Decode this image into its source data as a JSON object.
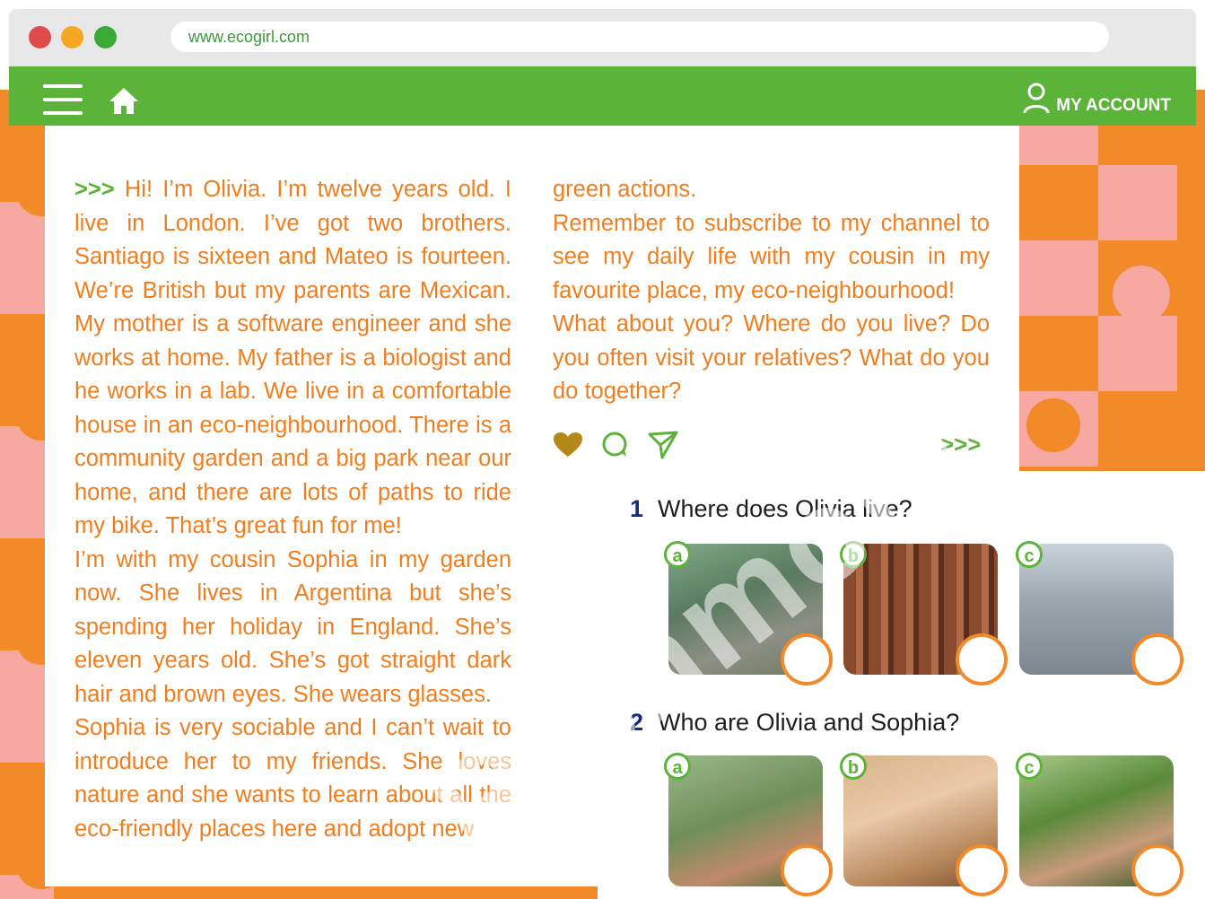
{
  "browser": {
    "url": "www.ecogirl.com",
    "traffic_lights": [
      "#e04a4a",
      "#f5a623",
      "#3aaa35"
    ]
  },
  "navbar": {
    "menu_icon": "hamburger-menu-icon",
    "home_icon": "home-icon",
    "account_icon": "user-icon",
    "account_label": "MY ACCOUNT"
  },
  "post": {
    "intro_arrows": ">>>",
    "col1_text": "Hi! I’m Olivia. I’m twelve years old. I live in London. I’ve got two brothers. Santiago is sixteen and Mateo is fourteen. We’re British but my parents are Mexican. My mother is a software engineer and she works at home. My father is a biologist and he works in a lab. We live in a comfortable house in an eco-neighbourhood. There is a community garden and a big park near our home, and there are lots of paths to ride my bike. That’s great fun for me!",
    "col1_text2": "I’m with my cousin Sophia in my garden now. She lives in Argentina but she’s spending her holiday in England. She’s eleven years old. She’s got straight dark hair and brown eyes. She wears glasses.",
    "col1_text3": "Sophia is very sociable and I can’t wait to introduce her to my friends. She loves nature and she wants to learn about all the eco-friendly places here and adopt new",
    "col2_text": "green actions.",
    "col2_text2": "Remember to subscribe to my channel to see my daily life with my cousin in my favourite place, my eco-neighbourhood!",
    "col2_text3": "What about you? Where do you live? Do you often visit your relatives? What do you do together?",
    "actions": [
      "heart-icon",
      "comment-icon",
      "share-icon"
    ],
    "more_arrows": ">>>"
  },
  "questions": [
    {
      "number": "1",
      "text": "Where does Olivia live?",
      "options": [
        "a",
        "b",
        "c"
      ]
    },
    {
      "number": "2",
      "text": "Who are Olivia and Sophia?",
      "options": [
        "a",
        "b",
        "c"
      ]
    }
  ],
  "watermark": "Richmond",
  "colors": {
    "green": "#5cb33a",
    "orange": "#f28a2a",
    "pink": "#f7a8a0",
    "text_orange": "#f07d1e",
    "navy": "#1a2a7a"
  }
}
